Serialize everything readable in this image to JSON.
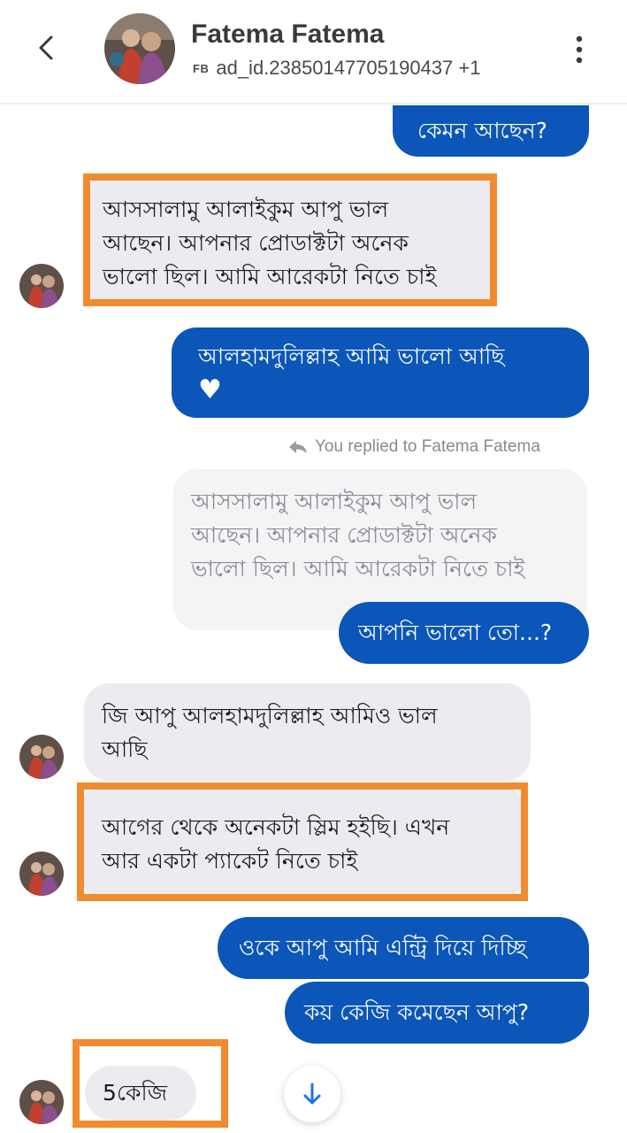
{
  "header": {
    "contact_name": "Fatema Fatema",
    "source_tag": "FB",
    "subtitle": "ad_id.23850147705190437 +1",
    "icons": {
      "back": "chevron-left-icon",
      "menu": "more-vertical-icon"
    }
  },
  "messages": [
    {
      "from": "me",
      "lines": [
        "কেমন আছেন?"
      ]
    },
    {
      "from": "contact",
      "highlighted": true,
      "lines": [
        "আসসালামু আলাইকুম আপু ভাল",
        "আছেন। আপনার প্রোডাক্টটা অনেক",
        "ভালো ছিল। আমি আরেকটা নিতে চাই"
      ]
    },
    {
      "from": "me",
      "lines": [
        "আলহামদুলিল্লাহ আমি ভালো আছি"
      ],
      "emoji": "♥"
    },
    {
      "from": "me",
      "reply_label": "You replied to Fatema Fatema",
      "quoted_lines": [
        "আসসালামু আলাইকুম আপু ভাল",
        "আছেন। আপনার প্রোডাক্টটা অনেক",
        "ভালো ছিল। আমি আরেকটা নিতে চাই"
      ],
      "lines": [
        "আপনি ভালো তো...?"
      ]
    },
    {
      "from": "contact",
      "lines": [
        "জি আপু আলহামদুলিল্লাহ আমিও ভাল",
        "আছি"
      ]
    },
    {
      "from": "contact",
      "highlighted": true,
      "lines": [
        "আগের থেকে অনেকটা স্লিম হইছি। এখন",
        "আর একটা প্যাকেট নিতে চাই"
      ]
    },
    {
      "from": "me",
      "lines": [
        "ওকে আপু আমি এন্ট্রি দিয়ে দিচ্ছি"
      ]
    },
    {
      "from": "me",
      "lines": [
        "কয় কেজি কমেছেন আপু?"
      ]
    },
    {
      "from": "contact",
      "highlighted": true,
      "lines": [
        "5কেজি"
      ]
    }
  ],
  "colors": {
    "outgoing": "#0b56b8",
    "incoming": "#ececf0",
    "highlight": "#f28b2f"
  },
  "scroll_button_icon": "arrow-down-icon"
}
